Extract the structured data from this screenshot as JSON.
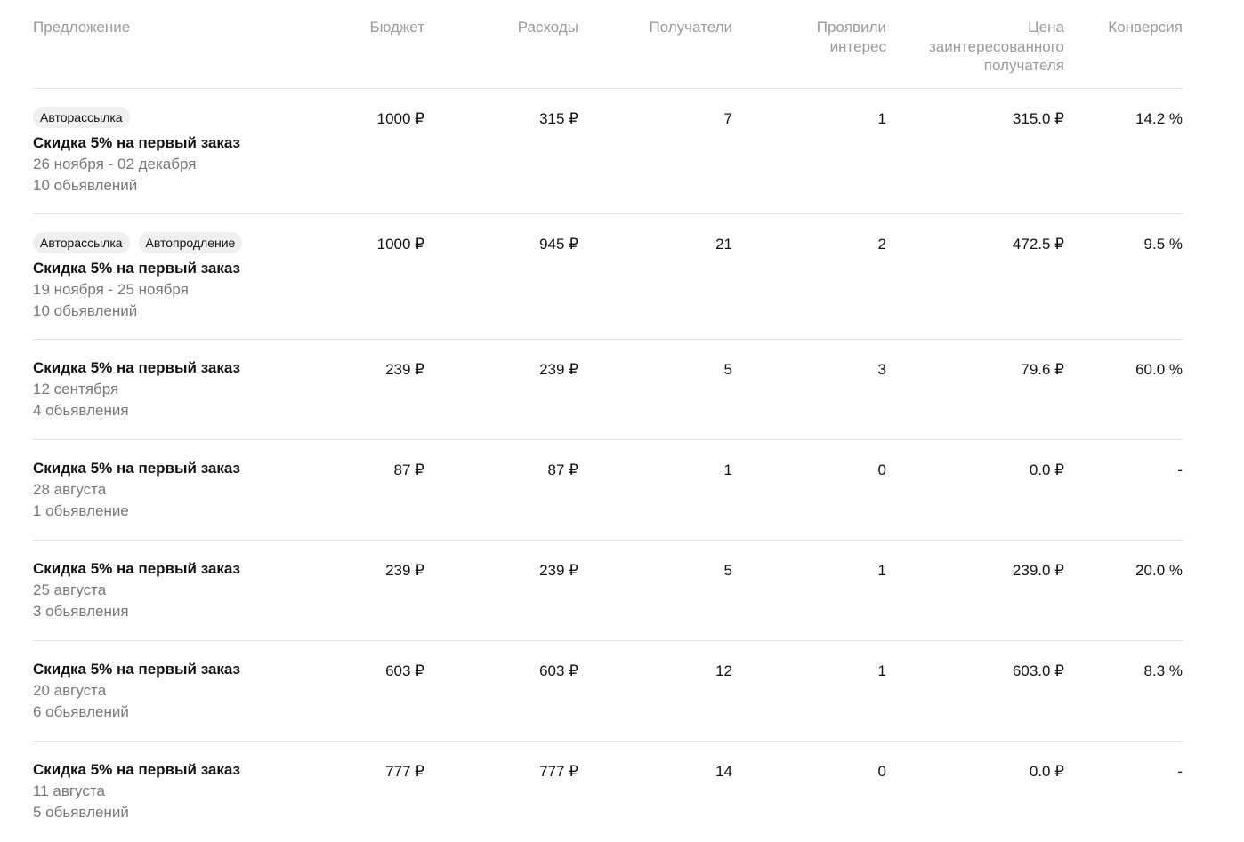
{
  "table": {
    "headers": {
      "offer": "Предложение",
      "budget": "Бюджет",
      "spend": "Расходы",
      "recipients": "Получатели",
      "interested_line1": "Проявили",
      "interested_line2": "интерес",
      "price_line1": "Цена",
      "price_line2": "заинтересованного",
      "price_line3": "получателя",
      "conversion": "Конверсия"
    },
    "rows": [
      {
        "tags": [
          "Авторассылка"
        ],
        "title": "Скидка 5% на первый заказ",
        "dates": "26 ноября - 02 декабря",
        "ads": "10 обьявлений",
        "budget": "1000 ₽",
        "spend": "315 ₽",
        "recipients": "7",
        "interested": "1",
        "price": "315.0 ₽",
        "conversion": "14.2 %"
      },
      {
        "tags": [
          "Авторассылка",
          "Автопродление"
        ],
        "title": "Скидка 5% на первый заказ",
        "dates": "19 ноября - 25 ноября",
        "ads": "10 обьявлений",
        "budget": "1000 ₽",
        "spend": "945 ₽",
        "recipients": "21",
        "interested": "2",
        "price": "472.5 ₽",
        "conversion": "9.5 %"
      },
      {
        "tags": [],
        "title": "Скидка 5% на первый заказ",
        "dates": "12 сентября",
        "ads": "4 обьявления",
        "budget": "239 ₽",
        "spend": "239 ₽",
        "recipients": "5",
        "interested": "3",
        "price": "79.6 ₽",
        "conversion": "60.0 %"
      },
      {
        "tags": [],
        "title": "Скидка 5% на первый заказ",
        "dates": "28 августа",
        "ads": "1 обьявление",
        "budget": "87 ₽",
        "spend": "87 ₽",
        "recipients": "1",
        "interested": "0",
        "price": "0.0 ₽",
        "conversion": "-"
      },
      {
        "tags": [],
        "title": "Скидка 5% на первый заказ",
        "dates": "25 августа",
        "ads": "3 обьявления",
        "budget": "239 ₽",
        "spend": "239 ₽",
        "recipients": "5",
        "interested": "1",
        "price": "239.0 ₽",
        "conversion": "20.0 %"
      },
      {
        "tags": [],
        "title": "Скидка 5% на первый заказ",
        "dates": "20 августа",
        "ads": "6 обьявлений",
        "budget": "603 ₽",
        "spend": "603 ₽",
        "recipients": "12",
        "interested": "1",
        "price": "603.0 ₽",
        "conversion": "8.3 %"
      },
      {
        "tags": [],
        "title": "Скидка 5% на первый заказ",
        "dates": "11 августа",
        "ads": "5 обьявлений",
        "budget": "777 ₽",
        "spend": "777 ₽",
        "recipients": "14",
        "interested": "0",
        "price": "0.0 ₽",
        "conversion": "-"
      }
    ]
  }
}
